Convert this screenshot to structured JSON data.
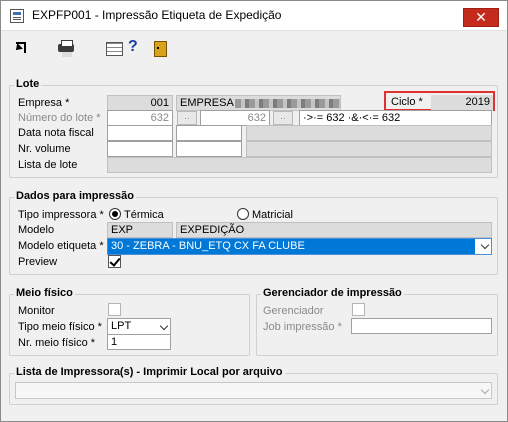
{
  "window": {
    "title": "EXPFP001 - Impressão Etiqueta de Expedição",
    "close_glyph": "✕"
  },
  "toolbar": {
    "icons": [
      "exit-icon",
      "printer-icon",
      "config-icon",
      "help-icon",
      "door-icon"
    ],
    "help_glyph": "?"
  },
  "lote": {
    "title": "Lote",
    "empresa_label": "Empresa *",
    "empresa_code": "001",
    "empresa_name": "EMPRESA",
    "ciclo_label": "Ciclo *",
    "ciclo_value": "2019",
    "numero_label": "Número do lote *",
    "numero_from": "632",
    "numero_to": "632",
    "range_text": "·>·= 632 ·&·<·= 632",
    "data_label": "Data nota fiscal",
    "volume_label": "Nr. volume",
    "lista_label": "Lista de lote"
  },
  "dados": {
    "title": "Dados para impressão",
    "tipo_label": "Tipo impressora *",
    "termica_label": "Térmica",
    "matricial_label": "Matricial",
    "modelo_label": "Modelo",
    "modelo_code": "EXP",
    "modelo_desc": "EXPEDIÇÃO",
    "etiqueta_label": "Modelo etiqueta *",
    "etiqueta_value": "30 - ZEBRA - BNU_ETQ CX FA CLUBE",
    "preview_label": "Preview"
  },
  "meio": {
    "title": "Meio físico",
    "monitor_label": "Monitor",
    "tipo_label": "Tipo meio físico *",
    "tipo_value": "LPT",
    "nr_label": "Nr. meio físico *",
    "nr_value": "1"
  },
  "gerenciador": {
    "title": "Gerenciador de impressão",
    "gerenciador_label": "Gerenciador",
    "job_label": "Job impressão *"
  },
  "lista": {
    "title": "Lista de Impressora(s) - Imprimir Local por arquivo"
  }
}
